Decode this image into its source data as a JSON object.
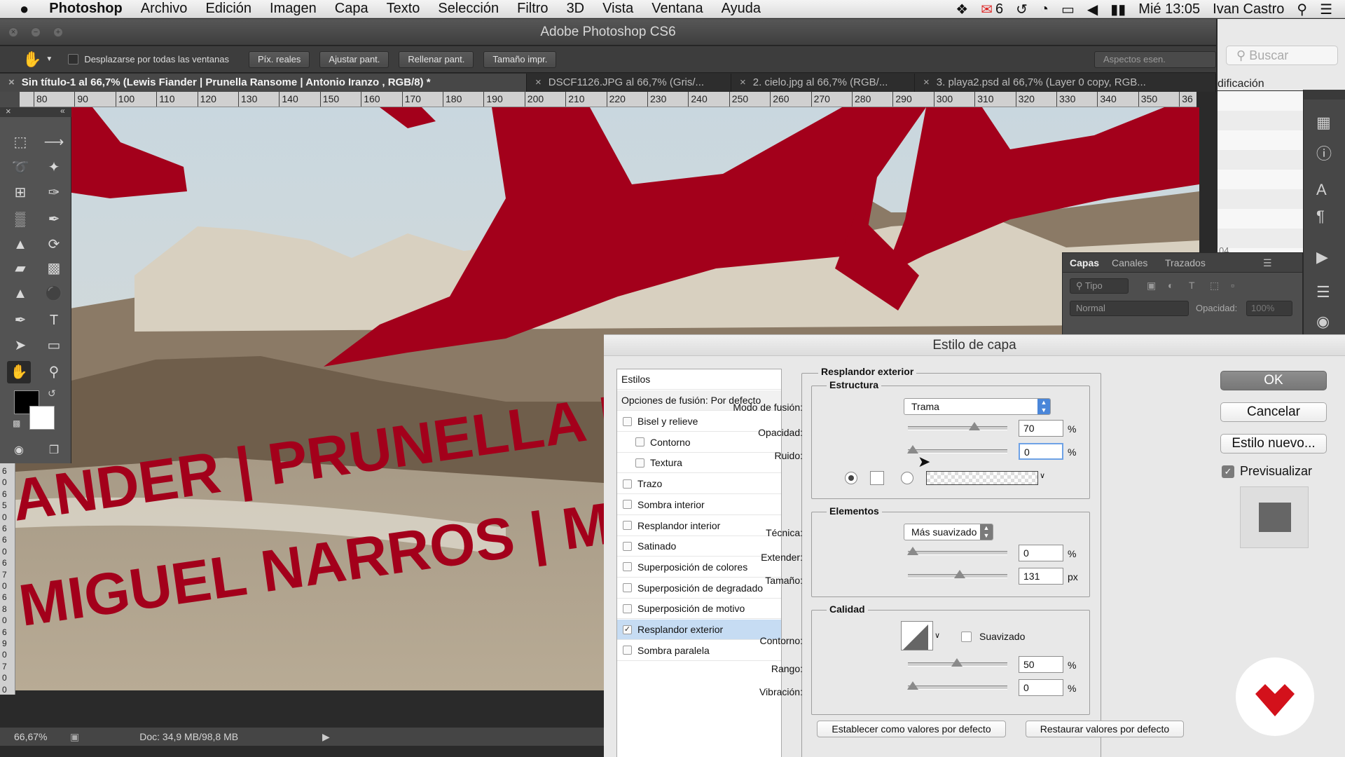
{
  "menubar": {
    "apple": "",
    "app": "Photoshop",
    "items": [
      "Archivo",
      "Edición",
      "Imagen",
      "Capa",
      "Texto",
      "Selección",
      "Filtro",
      "3D",
      "Vista",
      "Ventana",
      "Ayuda"
    ],
    "mail_count": "6",
    "clock": "Mié 13:05",
    "user": "Ivan Castro"
  },
  "window": {
    "title": "Adobe Photoshop CS6"
  },
  "options": {
    "scroll_all": "Desplazarse por todas las ventanas",
    "btn_actual": "Píx. reales",
    "btn_fit": "Ajustar pant.",
    "btn_fill": "Rellenar pant.",
    "btn_print": "Tamaño impr.",
    "workspace": "Aspectos esen."
  },
  "search": {
    "placeholder": "Buscar"
  },
  "tabs": [
    {
      "label": "Sin título-1 al 66,7% (Lewis Fiander   |   Prunella Ransome   |   Antonio Iranzo         , RGB/8) *"
    },
    {
      "label": "DSCF1126.JPG al 66,7% (Gris/..."
    },
    {
      "label": "2. cielo.jpg al 66,7% (RGB/..."
    },
    {
      "label": "3. playa2.psd al 66,7% (Layer 0 copy, RGB..."
    }
  ],
  "ruler": [
    "80",
    "90",
    "100",
    "110",
    "120",
    "130",
    "140",
    "150",
    "160",
    "170",
    "180",
    "190",
    "200",
    "210",
    "220",
    "230",
    "240",
    "250",
    "260",
    "270",
    "280",
    "290",
    "300",
    "310",
    "320",
    "330",
    "340",
    "350",
    "36"
  ],
  "vruler": [
    "6",
    "0",
    "6",
    "5",
    "0",
    "6",
    "6",
    "0",
    "6",
    "7",
    "0",
    "6",
    "8",
    "0",
    "6",
    "9",
    "0",
    "7",
    "0",
    "0"
  ],
  "canvas": {
    "line1": "ANDER   |   PRUNELLA RANSOM",
    "line2": "MIGUEL NARROS   |   MARIA LU"
  },
  "status": {
    "zoom": "66,67%",
    "doc": "Doc: 34,9 MB/98,8 MB"
  },
  "rightpanel": {
    "mod_label": "dificación",
    "count": "04"
  },
  "layers": {
    "tabs": [
      "Capas",
      "Canales",
      "Trazados"
    ],
    "kind": "Tipo",
    "blend": "Normal",
    "opacity_label": "Opacidad:",
    "opacity": "100%"
  },
  "dialog": {
    "title": "Estilo de capa",
    "styles_header": "Estilos",
    "blend_options": "Opciones de fusión: Por defecto",
    "effects": [
      {
        "label": "Bisel y relieve",
        "checked": false,
        "indent": false
      },
      {
        "label": "Contorno",
        "checked": false,
        "indent": true
      },
      {
        "label": "Textura",
        "checked": false,
        "indent": true
      },
      {
        "label": "Trazo",
        "checked": false,
        "indent": false
      },
      {
        "label": "Sombra interior",
        "checked": false,
        "indent": false
      },
      {
        "label": "Resplandor interior",
        "checked": false,
        "indent": false
      },
      {
        "label": "Satinado",
        "checked": false,
        "indent": false
      },
      {
        "label": "Superposición de colores",
        "checked": false,
        "indent": false
      },
      {
        "label": "Superposición de degradado",
        "checked": false,
        "indent": false
      },
      {
        "label": "Superposición de motivo",
        "checked": false,
        "indent": false
      },
      {
        "label": "Resplandor exterior",
        "checked": true,
        "indent": false
      },
      {
        "label": "Sombra paralela",
        "checked": false,
        "indent": false
      }
    ],
    "section_title": "Resplandor exterior",
    "structure": {
      "title": "Estructura",
      "blend_label": "Modo de fusión:",
      "blend_value": "Trama",
      "opacity_label": "Opacidad:",
      "opacity": "70",
      "opacity_unit": "%",
      "noise_label": "Ruido:",
      "noise": "0",
      "noise_unit": "%",
      "opacity_level": 0.7,
      "noise_level": 0.0
    },
    "elements": {
      "title": "Elementos",
      "technique_label": "Técnica:",
      "technique_value": "Más suavizado",
      "spread_label": "Extender:",
      "spread": "0",
      "spread_unit": "%",
      "size_label": "Tamaño:",
      "size": "131",
      "size_unit": "px",
      "spread_level": 0.0,
      "size_level": 0.53
    },
    "quality": {
      "title": "Calidad",
      "contour_label": "Contorno:",
      "antialias_label": "Suavizado",
      "range_label": "Rango:",
      "range": "50",
      "range_unit": "%",
      "jitter_label": "Vibración:",
      "jitter": "0",
      "jitter_unit": "%",
      "range_level": 0.5,
      "jitter_level": 0.0
    },
    "btn_default": "Establecer como valores por defecto",
    "btn_reset": "Restaurar valores por defecto",
    "ok": "OK",
    "cancel": "Cancelar",
    "new_style": "Estilo nuevo...",
    "preview": "Previsualizar"
  },
  "colors": {
    "accent": "#4a86d9",
    "poster_red": "#a3001b",
    "brand_red": "#d3111b"
  }
}
